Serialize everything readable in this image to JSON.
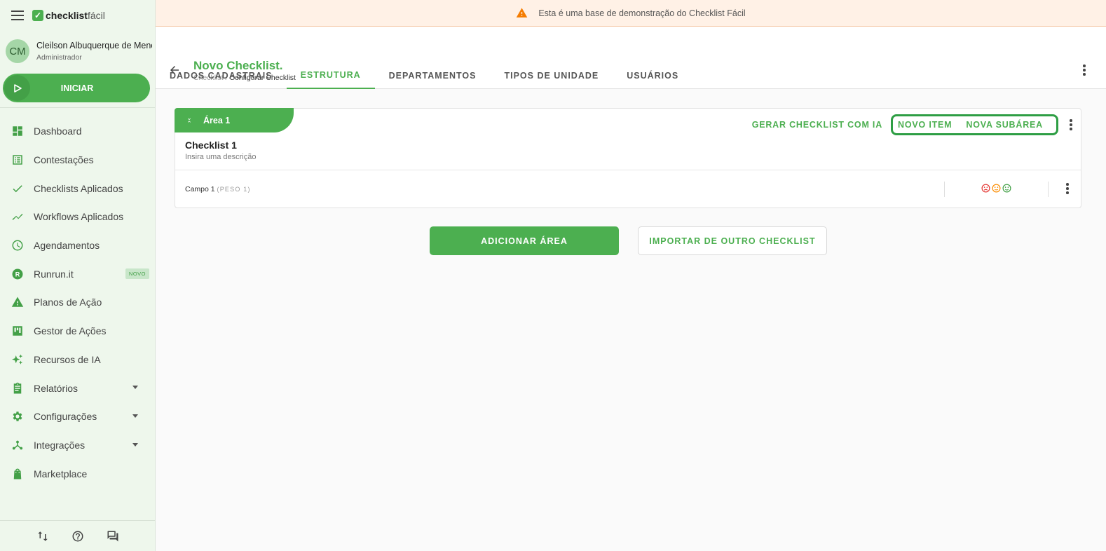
{
  "app": {
    "logo_bold": "checklist",
    "logo_light": "fácil"
  },
  "user": {
    "initials": "CM",
    "name": "Cleilson Albuquerque de Menezes",
    "role": "Administrador"
  },
  "start_button": {
    "label": "INICIAR"
  },
  "nav": [
    {
      "label": "Dashboard",
      "icon": "dashboard-icon"
    },
    {
      "label": "Contestações",
      "icon": "list-icon"
    },
    {
      "label": "Checklists Aplicados",
      "icon": "check-icon"
    },
    {
      "label": "Workflows Aplicados",
      "icon": "trending-icon"
    },
    {
      "label": "Agendamentos",
      "icon": "clock-icon"
    },
    {
      "label": "Runrun.it",
      "icon": "runrun-icon",
      "badge": "NOVO"
    },
    {
      "label": "Planos de Ação",
      "icon": "warning-icon"
    },
    {
      "label": "Gestor de Ações",
      "icon": "kanban-icon"
    },
    {
      "label": "Recursos de IA",
      "icon": "sparkle-icon"
    },
    {
      "label": "Relatórios",
      "icon": "clipboard-icon",
      "expandable": true
    },
    {
      "label": "Configurações",
      "icon": "gear-icon",
      "expandable": true
    },
    {
      "label": "Integrações",
      "icon": "integration-icon",
      "expandable": true
    },
    {
      "label": "Marketplace",
      "icon": "shopping-bag-icon"
    }
  ],
  "banner": {
    "text": "Esta é uma base de demonstração do Checklist Fácil",
    "color": "#f57c00"
  },
  "header": {
    "title": "Novo Checklist.",
    "breadcrumb_parent": "Checklist",
    "breadcrumb_sep": " / ",
    "breadcrumb_current": "Configurar Checklist"
  },
  "tabs": [
    {
      "label": "DADOS CADASTRAIS",
      "active": false
    },
    {
      "label": "ESTRUTURA",
      "active": true
    },
    {
      "label": "DEPARTAMENTOS",
      "active": false
    },
    {
      "label": "TIPOS DE UNIDADE",
      "active": false
    },
    {
      "label": "USUÁRIOS",
      "active": false
    }
  ],
  "area": {
    "label": "Área 1",
    "generate_ia": "GERAR CHECKLIST COM IA",
    "new_item": "NOVO ITEM",
    "new_subarea": "NOVA SUBÁREA",
    "checklist_title": "Checklist 1",
    "description_placeholder": "Insira uma descrição",
    "field": {
      "name": "Campo 1",
      "weight": "(PESO 1)"
    }
  },
  "buttons": {
    "add_area": "ADICIONAR ÁREA",
    "import": "IMPORTAR DE OUTRO CHECKLIST"
  },
  "colors": {
    "brand": "#4caf50",
    "face_bad": "#e53935",
    "face_neutral": "#fb8c00",
    "face_good": "#43a047"
  }
}
